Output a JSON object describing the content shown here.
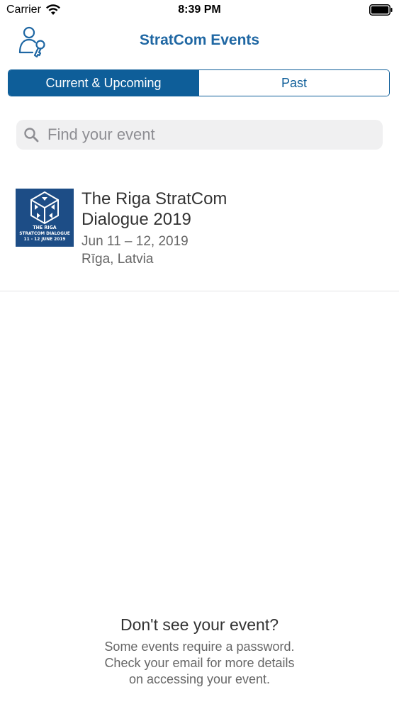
{
  "status_bar": {
    "carrier": "Carrier",
    "time": "8:39 PM",
    "wifi_icon": "wifi-icon",
    "battery_icon": "battery-icon"
  },
  "nav": {
    "title": "StratCom Events",
    "left_icon": "profile-key-icon",
    "accent_color": "#1f67a3"
  },
  "segments": {
    "active_color": "#0e5e99",
    "items": [
      {
        "label": "Current & Upcoming",
        "selected": true
      },
      {
        "label": "Past",
        "selected": false
      }
    ]
  },
  "search": {
    "placeholder": "Find your event",
    "value": "",
    "icon": "search-icon"
  },
  "events": [
    {
      "title": "The Riga StratCom Dialogue 2019",
      "dates": "Jun 11 – 12, 2019",
      "location": "Rīga, Latvia",
      "thumbnail": {
        "line1": "THE RIGA",
        "line2": "STRATCOM DIALOGUE",
        "line3": "11 - 12 JUNE 2019",
        "background": "#1d4d86"
      }
    }
  ],
  "help": {
    "title": "Don't see your event?",
    "lines": [
      "Some events require a password.",
      "Check your email for more details",
      "on accessing your event."
    ]
  }
}
